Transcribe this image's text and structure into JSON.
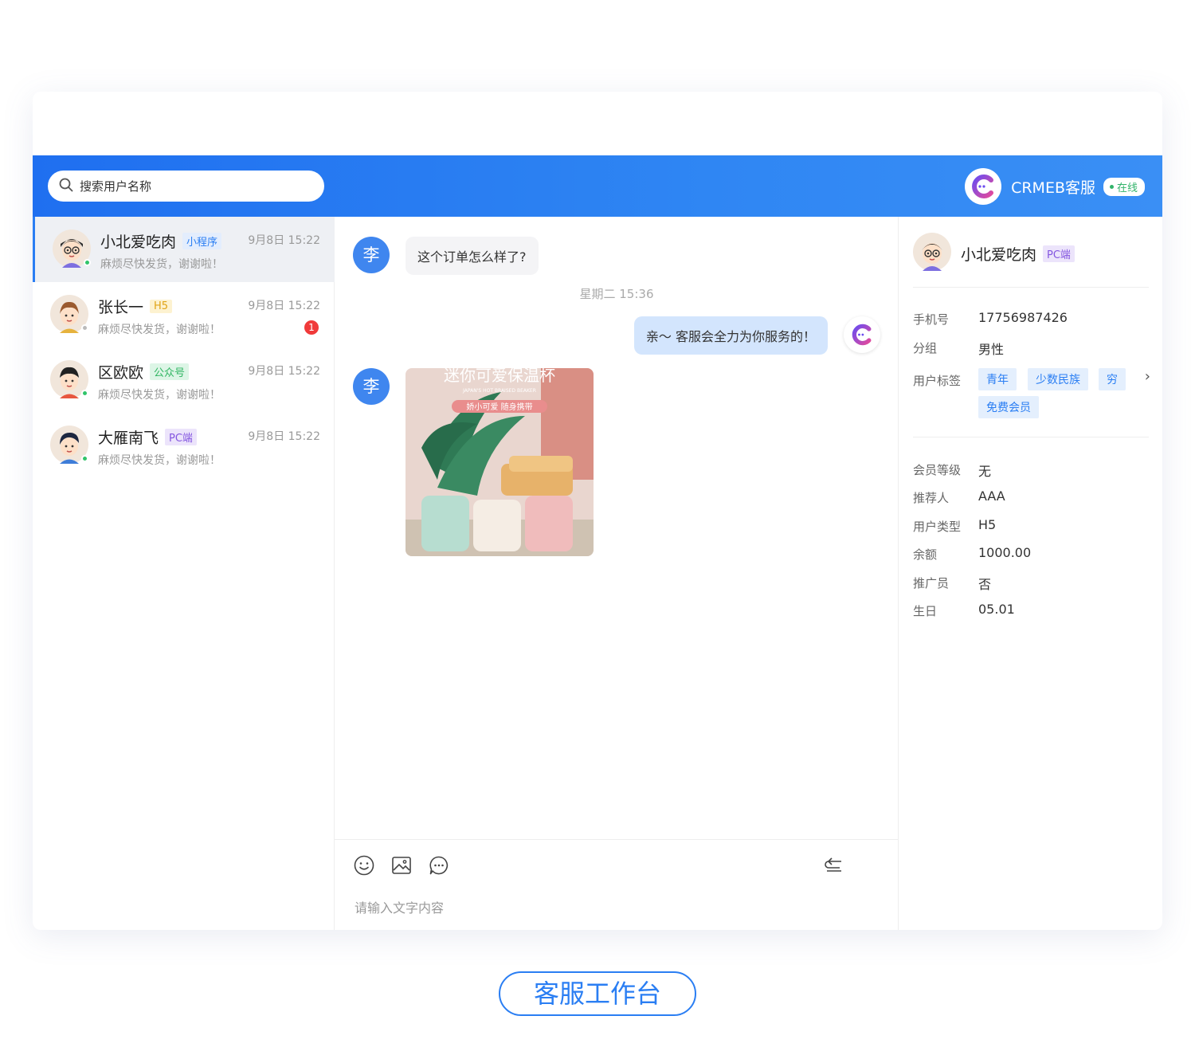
{
  "search": {
    "placeholder": "搜索用户名称"
  },
  "brand": {
    "name": "CRMEB客服",
    "status": "在线"
  },
  "conversations": [
    {
      "name": "小北爱吃肉",
      "tag": "小程序",
      "time": "9月8日 15:22",
      "message": "麻烦尽快发货，谢谢啦！",
      "unread": ""
    },
    {
      "name": "张长一",
      "tag": "H5",
      "time": "9月8日 15:22",
      "message": "麻烦尽快发货，谢谢啦！",
      "unread": "1"
    },
    {
      "name": "区欧欧",
      "tag": "公众号",
      "time": "9月8日 15:22",
      "message": "麻烦尽快发货，谢谢啦！",
      "unread": ""
    },
    {
      "name": "大雁南飞",
      "tag": "PC端",
      "time": "9月8日 15:22",
      "message": "麻烦尽快发货，谢谢啦！",
      "unread": ""
    }
  ],
  "chat": {
    "user_avatar_char": "李",
    "message_1": "这个订单怎么样了?",
    "time_divider": "星期二 15:36",
    "reply_1": "亲～ 客服会全力为你服务的！",
    "image": {
      "title": "迷你可爱保温杯",
      "subtitle": "JAPAN'S HOT BRAISED BEAKER",
      "badge": "娇小可爱 随身携带"
    },
    "input_placeholder": "请输入文字内容"
  },
  "profile": {
    "name": "小北爱吃肉",
    "tag": "PC端",
    "phone_label": "手机号",
    "phone": "17756987426",
    "group_label": "分组",
    "group": "男性",
    "tags_label": "用户标签",
    "tags": [
      "青年",
      "少数民族",
      "穷",
      "免费会员"
    ],
    "level_label": "会员等级",
    "level": "无",
    "referrer_label": "推荐人",
    "referrer": "AAA",
    "type_label": "用户类型",
    "type": "H5",
    "balance_label": "余额",
    "balance": "1000.00",
    "promoter_label": "推广员",
    "promoter": "否",
    "birthday_label": "生日",
    "birthday": "05.01"
  },
  "footer": {
    "title": "客服工作台"
  },
  "colors": {
    "primary": "#2a7ef3",
    "online": "#32b36a",
    "unread": "#f03a3a"
  }
}
